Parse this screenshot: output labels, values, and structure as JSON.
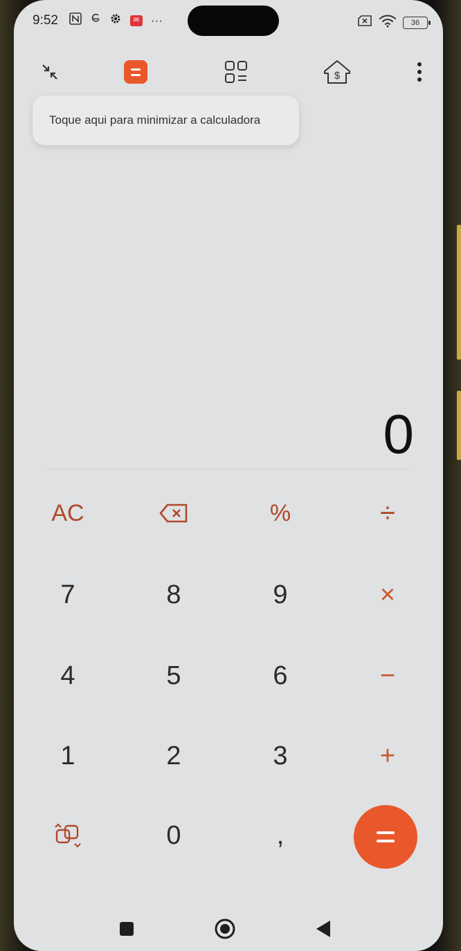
{
  "status_bar": {
    "time": "9:52",
    "battery": "36"
  },
  "toolbar": {
    "icons": [
      "minimize-icon",
      "calculator-icon",
      "converter-grid-icon",
      "finance-home-icon",
      "more-vert-icon"
    ]
  },
  "tooltip": {
    "text": "Toque aqui para minimizar a calculadora"
  },
  "display": {
    "value": "0"
  },
  "keypad": {
    "clear": "AC",
    "percent": "%",
    "divide": "÷",
    "multiply": "×",
    "minus": "−",
    "plus": "+",
    "decimal": ",",
    "digits": {
      "d0": "0",
      "d1": "1",
      "d2": "2",
      "d3": "3",
      "d4": "4",
      "d5": "5",
      "d6": "6",
      "d7": "7",
      "d8": "8",
      "d9": "9"
    }
  },
  "colors": {
    "accent": "#e9582a",
    "operator": "#c8592f",
    "background": "#dfe1e3"
  }
}
